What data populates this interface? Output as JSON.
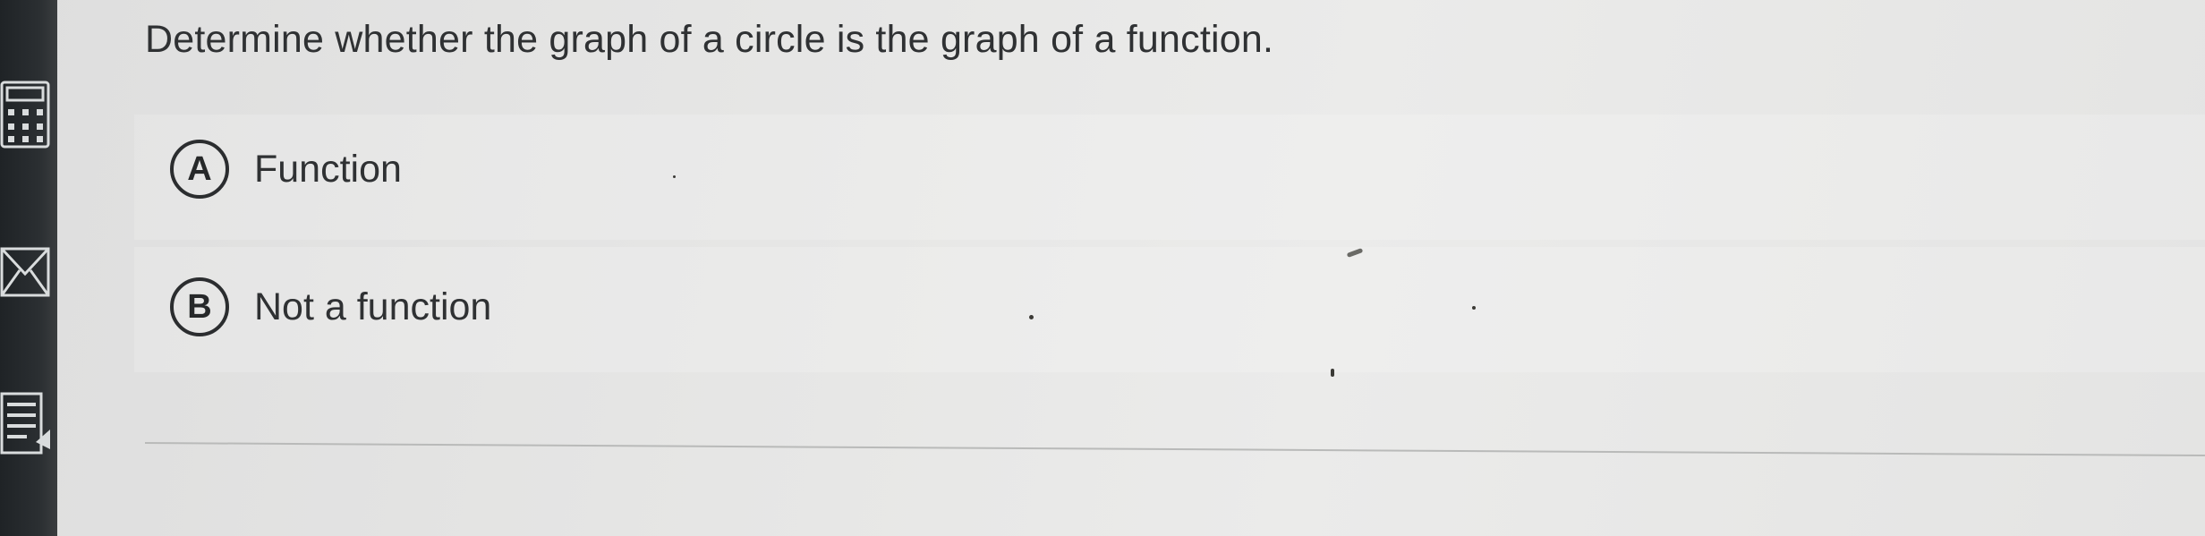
{
  "question": {
    "text": "Determine whether the graph of a circle is the graph of a function."
  },
  "choices": [
    {
      "letter": "A",
      "label": "Function"
    },
    {
      "letter": "B",
      "label": "Not a function"
    }
  ],
  "toolbar": {
    "icons": [
      "calculator-icon",
      "mail-icon",
      "document-icon"
    ]
  },
  "colors": {
    "text": "#2f3133",
    "background": "#e6e6e5",
    "toolbar": "#2b2f32"
  }
}
